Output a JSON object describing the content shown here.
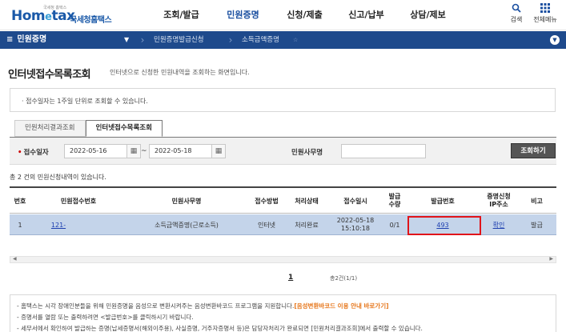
{
  "header": {
    "logo_tagline": "국세청 홈택스",
    "logo_brand_home": "Hom",
    "logo_brand_e": "e",
    "logo_brand_tax": "tax",
    "logo_sub": "국세청홈택스",
    "nav": [
      "조회/발급",
      "민원증명",
      "신청/제출",
      "신고/납부",
      "상담/제보"
    ],
    "search_label": "검색",
    "menu_label": "전체메뉴"
  },
  "subnav": {
    "menu_title": "민원증명",
    "breadcrumb_1": "민원증명발급신청",
    "breadcrumb_2": "소득금액증명"
  },
  "page": {
    "title": "인터넷접수목록조회",
    "description": "인터넷으로 신청한 민원내역을 조회하는 화면입니다.",
    "notice": "접수일자는 1주일 단위로 조회할 수 있습니다."
  },
  "tabs": [
    "민원처리결과조회",
    "인터넷접수목록조회"
  ],
  "search": {
    "date_label": "접수일자",
    "date_from": "2022-05-16",
    "date_to": "2022-05-18",
    "tilde": "~",
    "office_label": "민원사무명",
    "office_value": "",
    "button": "조회하기"
  },
  "result_count": "총 2 건의 민원신청내역이 있습니다.",
  "table": {
    "headers": {
      "no": "번호",
      "receipt_no": "민원접수번호",
      "office": "민원사무명",
      "method": "접수방법",
      "status": "처리상태",
      "received_at": "접수일시",
      "issue_qty_1": "발급",
      "issue_qty_2": "수량",
      "issue_no": "발급번호",
      "ip_1": "증명신청",
      "ip_2": "IP주소",
      "note": "비고"
    },
    "rows": [
      {
        "no": "1",
        "receipt_no": "121-",
        "office": "소득금액증명(근로소득)",
        "method": "인터넷",
        "status": "처리완료",
        "received_date": "2022-05-18",
        "received_time": "15:10:18",
        "issue_qty": "0/1",
        "issue_no": "493",
        "ip": "확인",
        "note": "발급"
      }
    ]
  },
  "pager": {
    "current": "1",
    "total": "총2건(1/1)"
  },
  "notes": {
    "line1_main": "- 홈택스는 시각 장애인분들을 위해 민원증명을 음성으로 변환시켜주는 음성변환바코드 프로그램을 지원합니다.",
    "line1_link": "[음성변환바코드 이용 안내 바로가기]",
    "line2": "- 증명서를 열람 또는 출력하려면 <발급번호>를 클릭하시기 바랍니다.",
    "line3": "- 세무서에서 확인하여 발급하는 증명(납세증명서(해외이주용), 사실증명, 거주자증명서 등)은 담당자처리가 완료되면 [민원처리결과조회]에서 출력할 수 있습니다."
  },
  "colors": {
    "brand": "#1a59a8",
    "subnav_bg": "#1e4a8c",
    "row_highlight": "#c4d4ea",
    "annotation_red": "#e0141a"
  }
}
